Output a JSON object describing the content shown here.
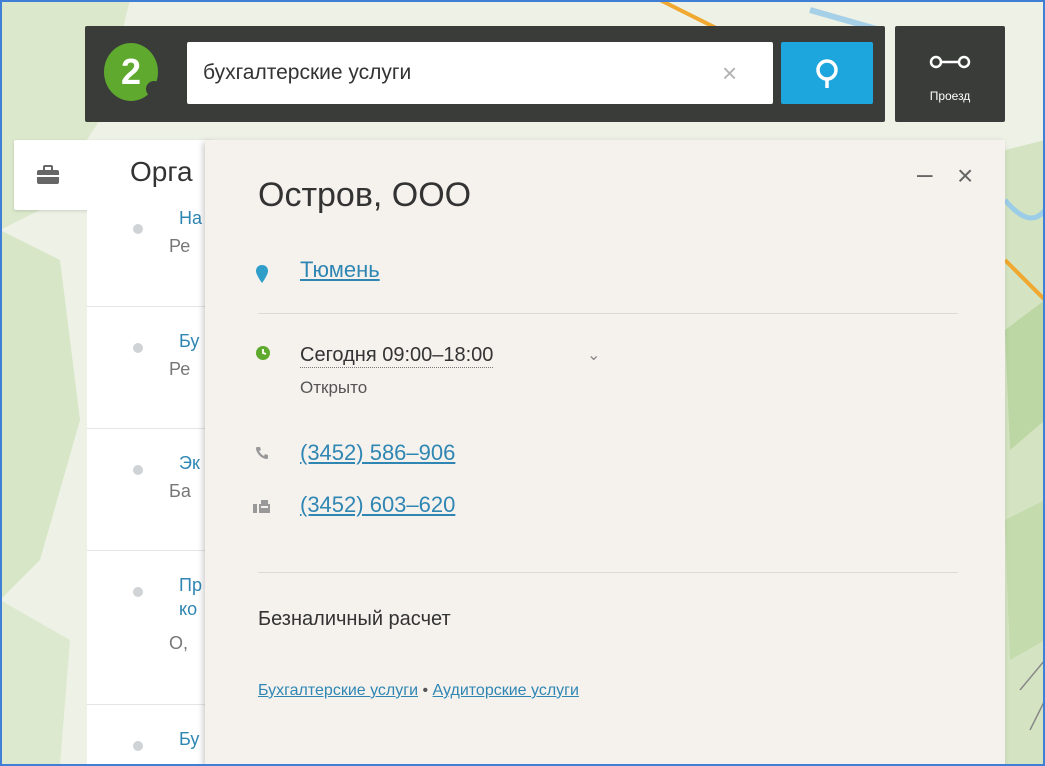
{
  "search": {
    "query": "бухгалтерские услуги",
    "logo_text": "2"
  },
  "route_button": {
    "label": "Проезд"
  },
  "results_tab": {
    "label": "Орга"
  },
  "results": [
    {
      "title": "На",
      "subtitle": "Ре"
    },
    {
      "title": "Бу",
      "subtitle": "Ре"
    },
    {
      "title": "Эк",
      "subtitle": "Ба"
    },
    {
      "title": "Пр",
      "title2": "ко",
      "subtitle": "О,"
    },
    {
      "title": "Бу",
      "subtitle": ""
    }
  ],
  "card": {
    "title": "Остров, ООО",
    "minimize": "–",
    "close": "×",
    "city": "Тюмень",
    "hours": "Сегодня 09:00–18:00",
    "hours_chevron": "⌄",
    "status": "Открыто",
    "phone": "(3452) 586–906",
    "fax": "(3452) 603–620",
    "payment": "Безналичный расчет",
    "categories": [
      "Бухгалтерские услуги",
      "Аудиторские услуги"
    ],
    "category_separator": " • "
  },
  "colors": {
    "brand_green": "#5fa92e",
    "search_blue": "#1da6dd",
    "link_blue": "#2f86b3",
    "bar_dark": "#3a3c3a",
    "card_bg": "#f5f2ee"
  },
  "icons": [
    "search-icon",
    "clear-icon",
    "route-icon",
    "briefcase-icon",
    "location-pin-icon",
    "clock-icon",
    "phone-icon",
    "fax-icon",
    "minimize-icon",
    "close-icon"
  ]
}
